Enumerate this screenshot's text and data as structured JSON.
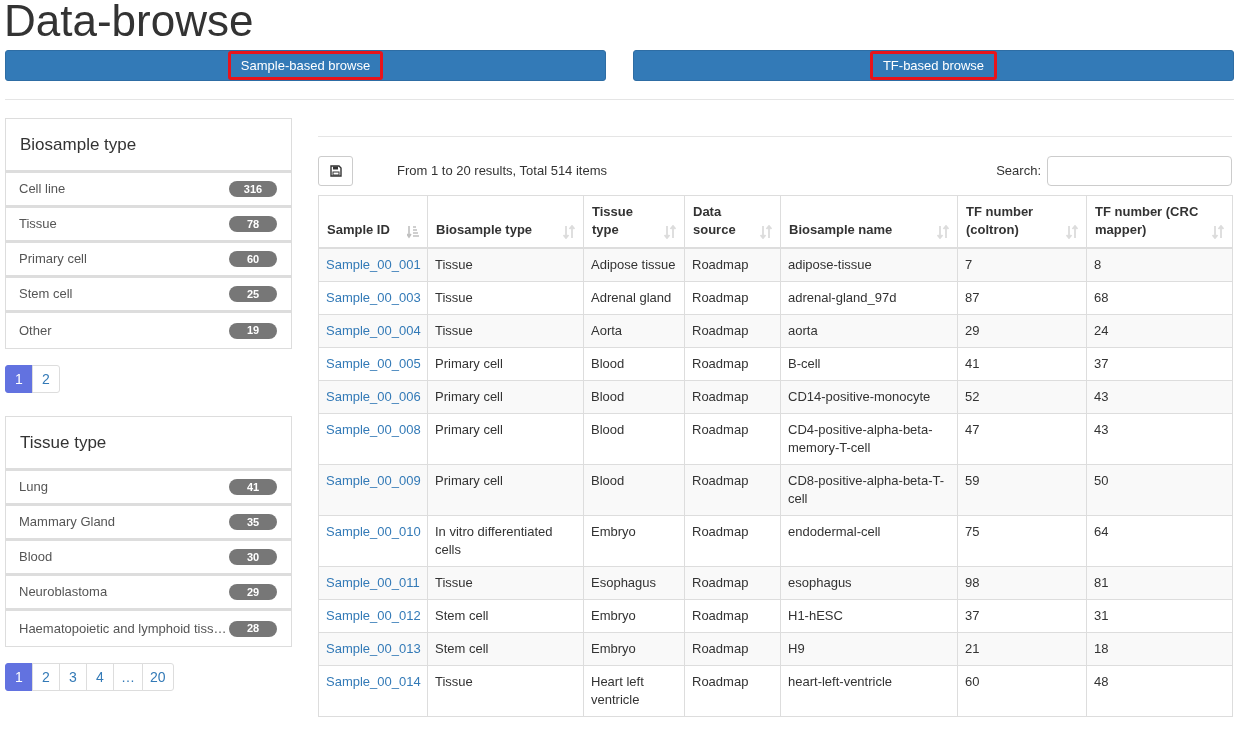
{
  "page_title": "Data-browse",
  "nav_buttons": [
    {
      "label": "Sample-based browse",
      "highlighted": true
    },
    {
      "label": "TF-based browse",
      "highlighted": true
    }
  ],
  "filter_panels": [
    {
      "title": "Biosample type",
      "items": [
        {
          "label": "Cell line",
          "count": "316"
        },
        {
          "label": "Tissue",
          "count": "78"
        },
        {
          "label": "Primary cell",
          "count": "60"
        },
        {
          "label": "Stem cell",
          "count": "25"
        },
        {
          "label": "Other",
          "count": "19"
        }
      ],
      "pages": [
        {
          "label": "1",
          "selected": true
        },
        {
          "label": "2",
          "selected": false
        }
      ]
    },
    {
      "title": "Tissue type",
      "items": [
        {
          "label": "Lung",
          "count": "41"
        },
        {
          "label": "Mammary Gland",
          "count": "35"
        },
        {
          "label": "Blood",
          "count": "30"
        },
        {
          "label": "Neuroblastoma",
          "count": "29"
        },
        {
          "label": "Haematopoietic and lymphoid tiss…",
          "count": "28"
        }
      ],
      "pages": [
        {
          "label": "1",
          "selected": true
        },
        {
          "label": "2",
          "selected": false
        },
        {
          "label": "3",
          "selected": false
        },
        {
          "label": "4",
          "selected": false
        },
        {
          "label": "…",
          "selected": false
        },
        {
          "label": "20",
          "selected": false
        }
      ]
    }
  ],
  "results_info": "From 1 to 20 results, Total 514 items",
  "search": {
    "label": "Search:"
  },
  "table": {
    "columns": [
      {
        "label": "Sample ID",
        "sorted": true
      },
      {
        "label": "Biosample type",
        "sorted": false
      },
      {
        "label": "Tissue type",
        "sorted": false
      },
      {
        "label": "Data source",
        "sorted": false
      },
      {
        "label": "Biosample name",
        "sorted": false
      },
      {
        "label": "TF number (coltron)",
        "sorted": false
      },
      {
        "label": "TF number (CRC mapper)",
        "sorted": false
      }
    ],
    "rows": [
      [
        "Sample_00_001",
        "Tissue",
        "Adipose tissue",
        "Roadmap",
        "adipose-tissue",
        "7",
        "8"
      ],
      [
        "Sample_00_003",
        "Tissue",
        "Adrenal gland",
        "Roadmap",
        "adrenal-gland_97d",
        "87",
        "68"
      ],
      [
        "Sample_00_004",
        "Tissue",
        "Aorta",
        "Roadmap",
        "aorta",
        "29",
        "24"
      ],
      [
        "Sample_00_005",
        "Primary cell",
        "Blood",
        "Roadmap",
        "B-cell",
        "41",
        "37"
      ],
      [
        "Sample_00_006",
        "Primary cell",
        "Blood",
        "Roadmap",
        "CD14-positive-monocyte",
        "52",
        "43"
      ],
      [
        "Sample_00_008",
        "Primary cell",
        "Blood",
        "Roadmap",
        "CD4-positive-alpha-beta-memory-T-cell",
        "47",
        "43"
      ],
      [
        "Sample_00_009",
        "Primary cell",
        "Blood",
        "Roadmap",
        "CD8-positive-alpha-beta-T-cell",
        "59",
        "50"
      ],
      [
        "Sample_00_010",
        "In vitro differentiated cells",
        "Embryo",
        "Roadmap",
        "endodermal-cell",
        "75",
        "64"
      ],
      [
        "Sample_00_011",
        "Tissue",
        "Esophagus",
        "Roadmap",
        "esophagus",
        "98",
        "81"
      ],
      [
        "Sample_00_012",
        "Stem cell",
        "Embryo",
        "Roadmap",
        "H1-hESC",
        "37",
        "31"
      ],
      [
        "Sample_00_013",
        "Stem cell",
        "Embryo",
        "Roadmap",
        "H9",
        "21",
        "18"
      ],
      [
        "Sample_00_014",
        "Tissue",
        "Heart left ventricle",
        "Roadmap",
        "heart-left-ventricle",
        "60",
        "48"
      ]
    ]
  }
}
